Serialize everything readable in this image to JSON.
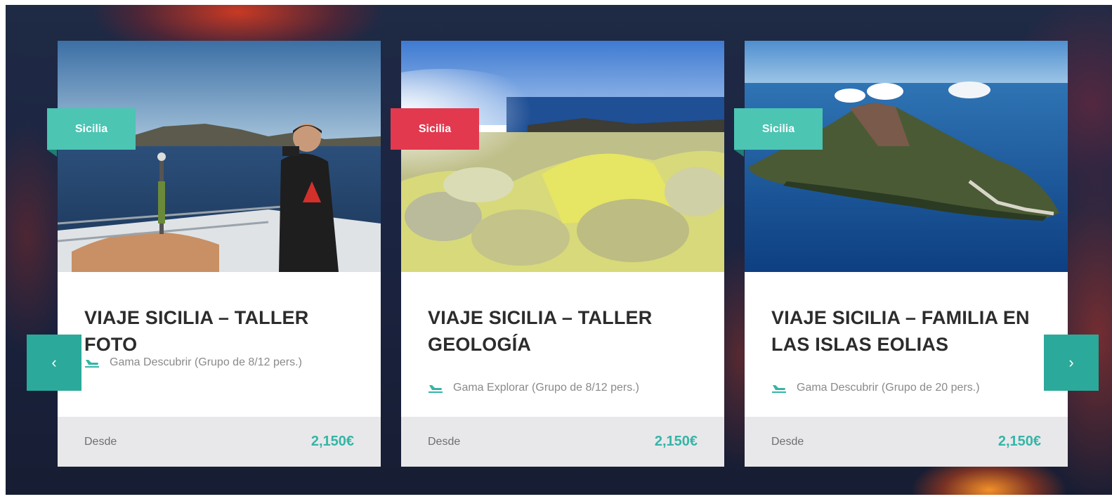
{
  "colors": {
    "accent": "#35b5a7",
    "tag_teal": "#4cc5b3",
    "tag_red": "#e2394f",
    "nav_button": "#2ba99b",
    "background": "#1b2441"
  },
  "carousel": {
    "prev_label": "‹",
    "next_label": "›",
    "cards": [
      {
        "tag": "Sicilia",
        "tag_color": "#4cc5b3",
        "image_icon": "photographer-on-boat-image",
        "title": "VIAJE SICILIA – TALLER FOTO",
        "meta_icon": "airplane-landing-icon",
        "meta": "Gama Descubrir (Grupo de 8/12 pers.)",
        "price_label": "Desde",
        "price": "2,150€"
      },
      {
        "tag": "Sicilia",
        "tag_color": "#e2394f",
        "image_icon": "sulfur-fumarole-image",
        "title": "VIAJE SICILIA – TALLER GEOLOGÍA",
        "meta_icon": "airplane-landing-icon",
        "meta": "Gama Explorar (Grupo de 8/12 pers.)",
        "price_label": "Desde",
        "price": "2,150€"
      },
      {
        "tag": "Sicilia",
        "tag_color": "#4cc5b3",
        "image_icon": "volcanic-island-image",
        "title": "VIAJE SICILIA – FAMILIA EN LAS ISLAS EOLIAS",
        "meta_icon": "airplane-landing-icon",
        "meta": "Gama Descubrir (Grupo de 20 pers.)",
        "price_label": "Desde",
        "price": "2,150€"
      }
    ]
  }
}
